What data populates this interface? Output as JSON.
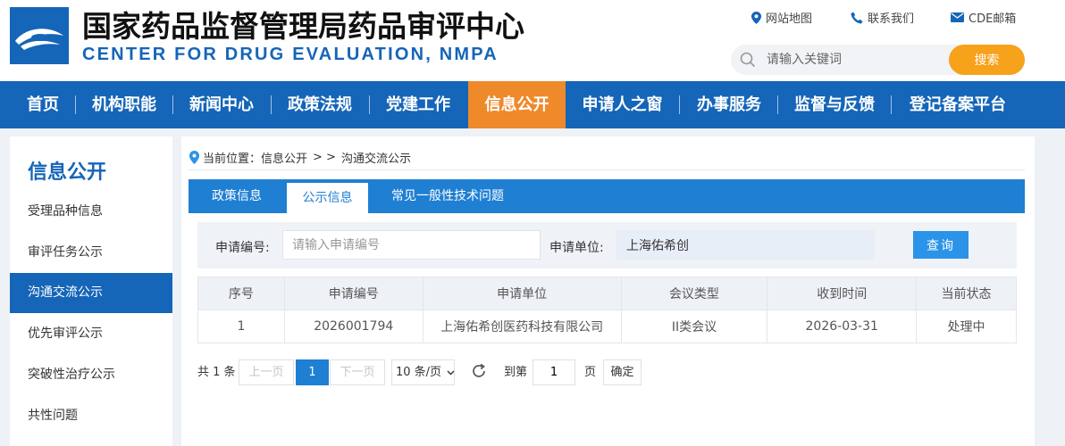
{
  "header": {
    "title_cn": "国家药品监督管理局药品审评中心",
    "title_en": "CENTER FOR DRUG EVALUATION, NMPA",
    "links": [
      {
        "label": "网站地图",
        "icon": "location-pin-icon"
      },
      {
        "label": "联系我们",
        "icon": "phone-icon"
      },
      {
        "label": "CDE邮箱",
        "icon": "mail-icon"
      }
    ],
    "search": {
      "placeholder": "请输入关键词",
      "button_label": "搜索"
    }
  },
  "colors": {
    "brand_blue": "#1565b8",
    "accent_orange": "#ef8a2b",
    "search_orange": "#f7a21b",
    "tab_blue": "#1f7fd2"
  },
  "nav": {
    "items": [
      {
        "label": "首页"
      },
      {
        "label": "机构职能"
      },
      {
        "label": "新闻中心"
      },
      {
        "label": "政策法规"
      },
      {
        "label": "党建工作"
      },
      {
        "label": "信息公开",
        "active": true
      },
      {
        "label": "申请人之窗"
      },
      {
        "label": "办事服务"
      },
      {
        "label": "监督与反馈"
      },
      {
        "label": "登记备案平台"
      }
    ]
  },
  "sidebar": {
    "title": "信息公开",
    "items": [
      {
        "label": "受理品种信息"
      },
      {
        "label": "审评任务公示"
      },
      {
        "label": "沟通交流公示",
        "active": true
      },
      {
        "label": "优先审评公示"
      },
      {
        "label": "突破性治疗公示"
      },
      {
        "label": "共性问题"
      }
    ]
  },
  "breadcrumb": {
    "prefix": "当前位置：",
    "section": "信息公开",
    "separator": "> >",
    "current": "沟通交流公示"
  },
  "tabs": [
    {
      "label": "政策信息"
    },
    {
      "label": "公示信息",
      "active": true
    },
    {
      "label": "常见一般性技术问题"
    }
  ],
  "filter": {
    "app_no_label": "申请编号:",
    "app_no_placeholder": "请输入申请编号",
    "app_no_value": "",
    "applicant_label": "申请单位:",
    "applicant_value": "上海佑希创",
    "query_label": "查询"
  },
  "table": {
    "headers": [
      "序号",
      "申请编号",
      "申请单位",
      "会议类型",
      "收到时间",
      "当前状态"
    ],
    "rows": [
      [
        "1",
        "2026001794",
        "上海佑希创医药科技有限公司",
        "II类会议",
        "2026-03-31",
        "处理中"
      ]
    ]
  },
  "pagination": {
    "total": "共 1 条",
    "prev": "上一页",
    "current_page": "1",
    "next": "下一页",
    "page_size": "10 条/页",
    "goto_label": "到第",
    "goto_value": "1",
    "page_unit": "页",
    "confirm": "确定"
  }
}
